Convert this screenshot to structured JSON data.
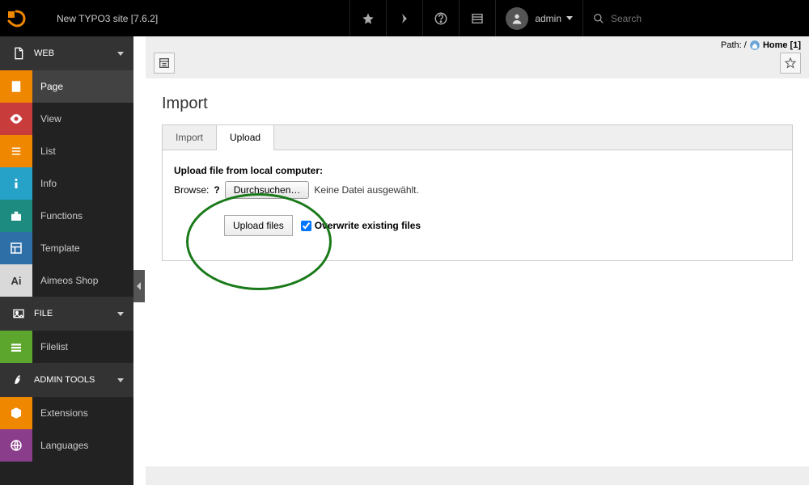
{
  "topbar": {
    "site_title": "New TYPO3 site [7.6.2]",
    "user_label": "admin",
    "search_placeholder": "Search"
  },
  "sidebar": {
    "sections": {
      "web": {
        "label": "WEB"
      },
      "file": {
        "label": "FILE"
      },
      "admin": {
        "label": "ADMIN TOOLS"
      }
    },
    "web_items": [
      {
        "label": "Page"
      },
      {
        "label": "View"
      },
      {
        "label": "List"
      },
      {
        "label": "Info"
      },
      {
        "label": "Functions"
      },
      {
        "label": "Template"
      },
      {
        "label": "Aimeos Shop"
      }
    ],
    "file_items": [
      {
        "label": "Filelist"
      }
    ],
    "admin_items": [
      {
        "label": "Extensions"
      },
      {
        "label": "Languages"
      }
    ]
  },
  "path": {
    "prefix": "Path: /",
    "home": "Home [1]"
  },
  "page": {
    "title": "Import",
    "tabs": {
      "import": "Import",
      "upload": "Upload"
    },
    "upload": {
      "heading": "Upload file from local computer:",
      "browse_label": "Browse:",
      "help": "?",
      "file_button": "Durchsuchen…",
      "no_file": "Keine Datei ausgewählt.",
      "upload_button": "Upload files",
      "overwrite_label": "Overwrite existing files"
    }
  }
}
